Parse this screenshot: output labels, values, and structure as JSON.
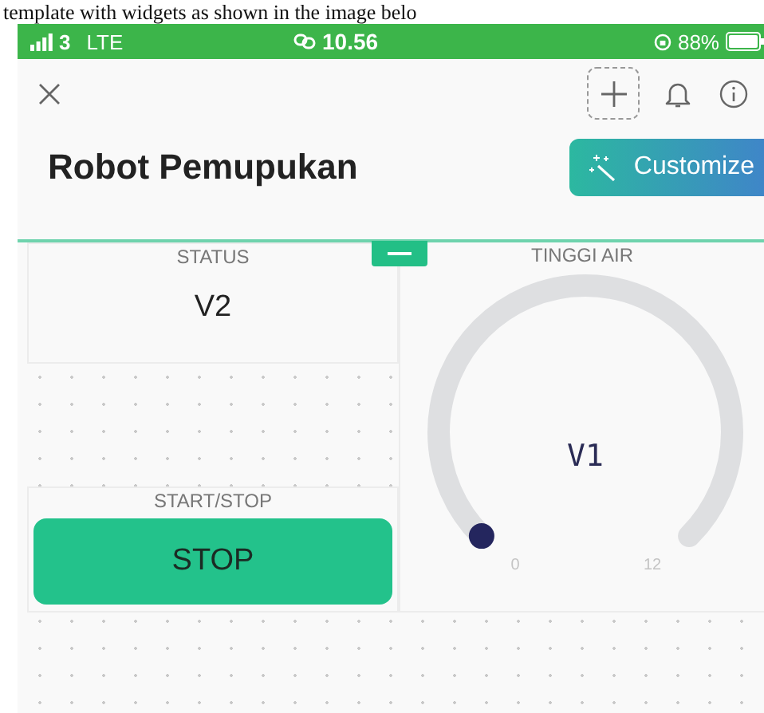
{
  "caption": "template with widgets as shown in the image belo",
  "status_bar": {
    "carrier": "3",
    "network": "LTE",
    "time": "10.56",
    "battery": "88%"
  },
  "header": {
    "title": "Robot Pemupukan",
    "customize_button": "Customize"
  },
  "widgets": [
    {
      "kind": "value_display",
      "title": "STATUS",
      "value": "V2"
    },
    {
      "kind": "button",
      "title": "START/STOP",
      "label": "STOP"
    },
    {
      "kind": "gauge",
      "title": "TINGGI AIR",
      "value": "V1",
      "min": "0",
      "max": "12"
    }
  ]
}
